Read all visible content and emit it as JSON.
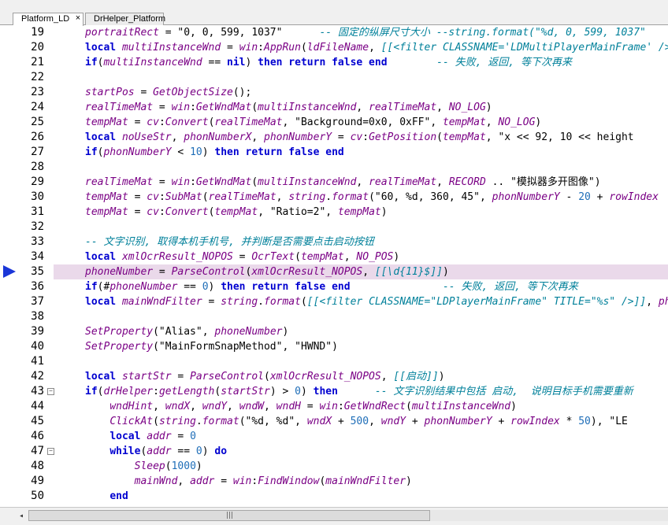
{
  "tabs": [
    {
      "label": "Platform_LD",
      "active": true,
      "close": "×"
    },
    {
      "label": "DrHelper_Platform",
      "active": false
    }
  ],
  "current_line": 35,
  "lines": [
    {
      "n": "19",
      "t": [
        [
          "id",
          "portraitRect"
        ],
        [
          "op",
          " = "
        ],
        [
          "str",
          "\"0, 0, 599, 1037\""
        ],
        [
          "op",
          "      "
        ],
        [
          "cm",
          "-- 固定的纵屏尺寸大小 --string.format(\"%d, 0, 599, 1037\""
        ]
      ]
    },
    {
      "n": "20",
      "t": [
        [
          "k",
          "local "
        ],
        [
          "id",
          "multiInstanceWnd"
        ],
        [
          "op",
          " = "
        ],
        [
          "id",
          "win"
        ],
        [
          "op",
          ":"
        ],
        [
          "fn",
          "AppRun"
        ],
        [
          "op",
          "("
        ],
        [
          "id",
          "ldFileName"
        ],
        [
          "op",
          ", "
        ],
        [
          "cm",
          "[[<filter CLASSNAME='LDMultiPlayerMainFrame' />]]"
        ]
      ]
    },
    {
      "n": "21",
      "t": [
        [
          "k",
          "if"
        ],
        [
          "op",
          "("
        ],
        [
          "id",
          "multiInstanceWnd"
        ],
        [
          "op",
          " == "
        ],
        [
          "k",
          "nil"
        ],
        [
          "op",
          ") "
        ],
        [
          "k",
          "then return false end"
        ],
        [
          "op",
          "        "
        ],
        [
          "cm",
          "-- 失败, 返回, 等下次再来"
        ]
      ]
    },
    {
      "n": "22",
      "t": []
    },
    {
      "n": "23",
      "t": [
        [
          "id",
          "startPos"
        ],
        [
          "op",
          " = "
        ],
        [
          "fn",
          "GetObjectSize"
        ],
        [
          "op",
          "();"
        ]
      ]
    },
    {
      "n": "24",
      "t": [
        [
          "id",
          "realTimeMat"
        ],
        [
          "op",
          " = "
        ],
        [
          "id",
          "win"
        ],
        [
          "op",
          ":"
        ],
        [
          "fn",
          "GetWndMat"
        ],
        [
          "op",
          "("
        ],
        [
          "id",
          "multiInstanceWnd"
        ],
        [
          "op",
          ", "
        ],
        [
          "id",
          "realTimeMat"
        ],
        [
          "op",
          ", "
        ],
        [
          "id",
          "NO_LOG"
        ],
        [
          "op",
          ")"
        ]
      ]
    },
    {
      "n": "25",
      "t": [
        [
          "id",
          "tempMat"
        ],
        [
          "op",
          " = "
        ],
        [
          "id",
          "cv"
        ],
        [
          "op",
          ":"
        ],
        [
          "fn",
          "Convert"
        ],
        [
          "op",
          "("
        ],
        [
          "id",
          "realTimeMat"
        ],
        [
          "op",
          ", "
        ],
        [
          "str",
          "\"Background=0x0, 0xFF\""
        ],
        [
          "op",
          ", "
        ],
        [
          "id",
          "tempMat"
        ],
        [
          "op",
          ", "
        ],
        [
          "id",
          "NO_LOG"
        ],
        [
          "op",
          ")"
        ]
      ]
    },
    {
      "n": "26",
      "t": [
        [
          "k",
          "local "
        ],
        [
          "id",
          "noUseStr"
        ],
        [
          "op",
          ", "
        ],
        [
          "id",
          "phonNumberX"
        ],
        [
          "op",
          ", "
        ],
        [
          "id",
          "phonNumberY"
        ],
        [
          "op",
          " = "
        ],
        [
          "id",
          "cv"
        ],
        [
          "op",
          ":"
        ],
        [
          "fn",
          "GetPosition"
        ],
        [
          "op",
          "("
        ],
        [
          "id",
          "tempMat"
        ],
        [
          "op",
          ", "
        ],
        [
          "str",
          "\"x << 92, 10 << height"
        ]
      ]
    },
    {
      "n": "27",
      "t": [
        [
          "k",
          "if"
        ],
        [
          "op",
          "("
        ],
        [
          "id",
          "phonNumberY"
        ],
        [
          "op",
          " < "
        ],
        [
          "num",
          "10"
        ],
        [
          "op",
          ") "
        ],
        [
          "k",
          "then return false end"
        ]
      ]
    },
    {
      "n": "28",
      "t": []
    },
    {
      "n": "29",
      "t": [
        [
          "id",
          "realTimeMat"
        ],
        [
          "op",
          " = "
        ],
        [
          "id",
          "win"
        ],
        [
          "op",
          ":"
        ],
        [
          "fn",
          "GetWndMat"
        ],
        [
          "op",
          "("
        ],
        [
          "id",
          "multiInstanceWnd"
        ],
        [
          "op",
          ", "
        ],
        [
          "id",
          "realTimeMat"
        ],
        [
          "op",
          ", "
        ],
        [
          "id",
          "RECORD"
        ],
        [
          "op",
          " .. "
        ],
        [
          "str",
          "\"模拟器多开图像\""
        ],
        [
          "op",
          ")"
        ]
      ]
    },
    {
      "n": "30",
      "t": [
        [
          "id",
          "tempMat"
        ],
        [
          "op",
          " = "
        ],
        [
          "id",
          "cv"
        ],
        [
          "op",
          ":"
        ],
        [
          "fn",
          "SubMat"
        ],
        [
          "op",
          "("
        ],
        [
          "id",
          "realTimeMat"
        ],
        [
          "op",
          ", "
        ],
        [
          "id",
          "string"
        ],
        [
          "op",
          "."
        ],
        [
          "fn",
          "format"
        ],
        [
          "op",
          "("
        ],
        [
          "str",
          "\"60, %d, 360, 45\""
        ],
        [
          "op",
          ", "
        ],
        [
          "id",
          "phonNumberY"
        ],
        [
          "op",
          " - "
        ],
        [
          "num",
          "20"
        ],
        [
          "op",
          " + "
        ],
        [
          "id",
          "rowIndex"
        ]
      ]
    },
    {
      "n": "31",
      "t": [
        [
          "id",
          "tempMat"
        ],
        [
          "op",
          " = "
        ],
        [
          "id",
          "cv"
        ],
        [
          "op",
          ":"
        ],
        [
          "fn",
          "Convert"
        ],
        [
          "op",
          "("
        ],
        [
          "id",
          "tempMat"
        ],
        [
          "op",
          ", "
        ],
        [
          "str",
          "\"Ratio=2\""
        ],
        [
          "op",
          ", "
        ],
        [
          "id",
          "tempMat"
        ],
        [
          "op",
          ")"
        ]
      ]
    },
    {
      "n": "32",
      "t": []
    },
    {
      "n": "33",
      "t": [
        [
          "cm",
          "-- 文字识别, 取得本机手机号, 并判断是否需要点击启动按钮"
        ]
      ]
    },
    {
      "n": "34",
      "t": [
        [
          "k",
          "local "
        ],
        [
          "id",
          "xmlOcrResult_NOPOS"
        ],
        [
          "op",
          " = "
        ],
        [
          "fn",
          "OcrText"
        ],
        [
          "op",
          "("
        ],
        [
          "id",
          "tempMat"
        ],
        [
          "op",
          ", "
        ],
        [
          "id",
          "NO_POS"
        ],
        [
          "op",
          ")"
        ]
      ]
    },
    {
      "n": "35",
      "t": [
        [
          "id",
          "phoneNumber"
        ],
        [
          "op",
          " = "
        ],
        [
          "fn",
          "ParseControl"
        ],
        [
          "op",
          "("
        ],
        [
          "id",
          "xmlOcrResult_NOPOS"
        ],
        [
          "op",
          ", "
        ],
        [
          "cm",
          "[[\\d{11}$]]"
        ],
        [
          "op",
          ")"
        ]
      ]
    },
    {
      "n": "36",
      "t": [
        [
          "k",
          "if"
        ],
        [
          "op",
          "(#"
        ],
        [
          "id",
          "phoneNumber"
        ],
        [
          "op",
          " == "
        ],
        [
          "num",
          "0"
        ],
        [
          "op",
          ") "
        ],
        [
          "k",
          "then return false end"
        ],
        [
          "op",
          "               "
        ],
        [
          "cm",
          "-- 失败, 返回, 等下次再来"
        ]
      ]
    },
    {
      "n": "37",
      "t": [
        [
          "k",
          "local "
        ],
        [
          "id",
          "mainWndFilter"
        ],
        [
          "op",
          " = "
        ],
        [
          "id",
          "string"
        ],
        [
          "op",
          "."
        ],
        [
          "fn",
          "format"
        ],
        [
          "op",
          "("
        ],
        [
          "cm",
          "[[<filter CLASSNAME=\"LDPlayerMainFrame\" TITLE=\"%s\" />]]"
        ],
        [
          "op",
          ", "
        ],
        [
          "id",
          "phon"
        ]
      ]
    },
    {
      "n": "38",
      "t": []
    },
    {
      "n": "39",
      "t": [
        [
          "fn",
          "SetProperty"
        ],
        [
          "op",
          "("
        ],
        [
          "str",
          "\"Alias\""
        ],
        [
          "op",
          ", "
        ],
        [
          "id",
          "phoneNumber"
        ],
        [
          "op",
          ")"
        ]
      ]
    },
    {
      "n": "40",
      "t": [
        [
          "fn",
          "SetProperty"
        ],
        [
          "op",
          "("
        ],
        [
          "str",
          "\"MainFormSnapMethod\""
        ],
        [
          "op",
          ", "
        ],
        [
          "str",
          "\"HWND\""
        ],
        [
          "op",
          ")"
        ]
      ]
    },
    {
      "n": "41",
      "t": []
    },
    {
      "n": "42",
      "t": [
        [
          "k",
          "local "
        ],
        [
          "id",
          "startStr"
        ],
        [
          "op",
          " = "
        ],
        [
          "fn",
          "ParseControl"
        ],
        [
          "op",
          "("
        ],
        [
          "id",
          "xmlOcrResult_NOPOS"
        ],
        [
          "op",
          ", "
        ],
        [
          "cm",
          "[[启动]]"
        ],
        [
          "op",
          ")"
        ]
      ]
    },
    {
      "n": "43",
      "fold": "⊖",
      "t": [
        [
          "k",
          "if"
        ],
        [
          "op",
          "("
        ],
        [
          "id",
          "drHelper"
        ],
        [
          "op",
          ":"
        ],
        [
          "fn",
          "getLength"
        ],
        [
          "op",
          "("
        ],
        [
          "id",
          "startStr"
        ],
        [
          "op",
          ") > "
        ],
        [
          "num",
          "0"
        ],
        [
          "op",
          ") "
        ],
        [
          "k",
          "then"
        ],
        [
          "op",
          "      "
        ],
        [
          "cm",
          "-- 文字识别结果中包括 启动,  说明目标手机需要重新"
        ]
      ]
    },
    {
      "n": "44",
      "t": [
        [
          "op",
          "    "
        ],
        [
          "id",
          "wndHint"
        ],
        [
          "op",
          ", "
        ],
        [
          "id",
          "wndX"
        ],
        [
          "op",
          ", "
        ],
        [
          "id",
          "wndY"
        ],
        [
          "op",
          ", "
        ],
        [
          "id",
          "wndW"
        ],
        [
          "op",
          ", "
        ],
        [
          "id",
          "wndH"
        ],
        [
          "op",
          " = "
        ],
        [
          "id",
          "win"
        ],
        [
          "op",
          ":"
        ],
        [
          "fn",
          "GetWndRect"
        ],
        [
          "op",
          "("
        ],
        [
          "id",
          "multiInstanceWnd"
        ],
        [
          "op",
          ")"
        ]
      ]
    },
    {
      "n": "45",
      "t": [
        [
          "op",
          "    "
        ],
        [
          "fn",
          "ClickAt"
        ],
        [
          "op",
          "("
        ],
        [
          "id",
          "string"
        ],
        [
          "op",
          "."
        ],
        [
          "fn",
          "format"
        ],
        [
          "op",
          "("
        ],
        [
          "str",
          "\"%d, %d\""
        ],
        [
          "op",
          ", "
        ],
        [
          "id",
          "wndX"
        ],
        [
          "op",
          " + "
        ],
        [
          "num",
          "500"
        ],
        [
          "op",
          ", "
        ],
        [
          "id",
          "wndY"
        ],
        [
          "op",
          " + "
        ],
        [
          "id",
          "phonNumberY"
        ],
        [
          "op",
          " + "
        ],
        [
          "id",
          "rowIndex"
        ],
        [
          "op",
          " * "
        ],
        [
          "num",
          "50"
        ],
        [
          "op",
          "), "
        ],
        [
          "str",
          "\"LE"
        ]
      ]
    },
    {
      "n": "46",
      "t": [
        [
          "op",
          "    "
        ],
        [
          "k",
          "local "
        ],
        [
          "id",
          "addr"
        ],
        [
          "op",
          " = "
        ],
        [
          "num",
          "0"
        ]
      ]
    },
    {
      "n": "47",
      "fold": "⊖",
      "t": [
        [
          "op",
          "    "
        ],
        [
          "k",
          "while"
        ],
        [
          "op",
          "("
        ],
        [
          "id",
          "addr"
        ],
        [
          "op",
          " == "
        ],
        [
          "num",
          "0"
        ],
        [
          "op",
          ") "
        ],
        [
          "k",
          "do"
        ]
      ]
    },
    {
      "n": "48",
      "t": [
        [
          "op",
          "        "
        ],
        [
          "fn",
          "Sleep"
        ],
        [
          "op",
          "("
        ],
        [
          "num",
          "1000"
        ],
        [
          "op",
          ")"
        ]
      ]
    },
    {
      "n": "49",
      "t": [
        [
          "op",
          "        "
        ],
        [
          "id",
          "mainWnd"
        ],
        [
          "op",
          ", "
        ],
        [
          "id",
          "addr"
        ],
        [
          "op",
          " = "
        ],
        [
          "id",
          "win"
        ],
        [
          "op",
          ":"
        ],
        [
          "fn",
          "FindWindow"
        ],
        [
          "op",
          "("
        ],
        [
          "id",
          "mainWndFilter"
        ],
        [
          "op",
          ")"
        ]
      ]
    },
    {
      "n": "50",
      "t": [
        [
          "op",
          "    "
        ],
        [
          "k",
          "end"
        ]
      ]
    }
  ],
  "scrollbar": {
    "left_arrow": "◂",
    "right_arrow": "▸",
    "grip": "|||"
  }
}
